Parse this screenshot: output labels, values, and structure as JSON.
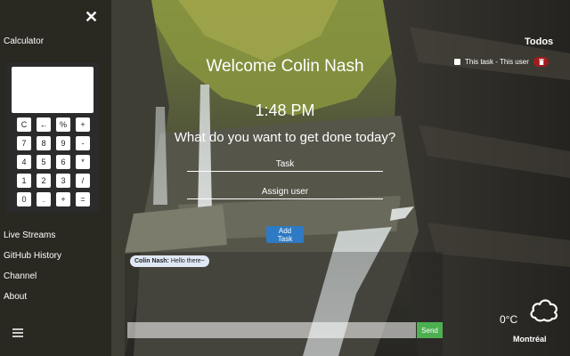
{
  "sidebar": {
    "close_glyph": "✕",
    "calculator_title": "Calculator",
    "calculator_keys": [
      "C",
      "←",
      "%",
      "+",
      "7",
      "8",
      "9",
      "-",
      "4",
      "5",
      "6",
      "*",
      "1",
      "2",
      "3",
      "/",
      "0",
      ".",
      "+",
      "="
    ],
    "nav": [
      "Live Streams",
      "GitHub History",
      "Channel",
      "About"
    ]
  },
  "main": {
    "welcome": "Welcome Colin Nash",
    "clock": "1:48 PM",
    "question": "What do you want to get done today?",
    "task_placeholder": "Task",
    "assign_placeholder": "Assign user",
    "add_task_label": "Add Task"
  },
  "chat": {
    "message_user": "Colin Nash:",
    "message_text": "Hello there~",
    "send_label": "Send",
    "input_value": ""
  },
  "todos": {
    "title": "Todos",
    "items": [
      {
        "text": "This task - This user"
      }
    ]
  },
  "weather": {
    "temperature": "0°C",
    "city": "Montréal",
    "icon": "cloud-icon"
  },
  "colors": {
    "add_task_button": "#2f7ac4",
    "send_button": "#4caf50",
    "delete_button": "#a01c1c"
  }
}
